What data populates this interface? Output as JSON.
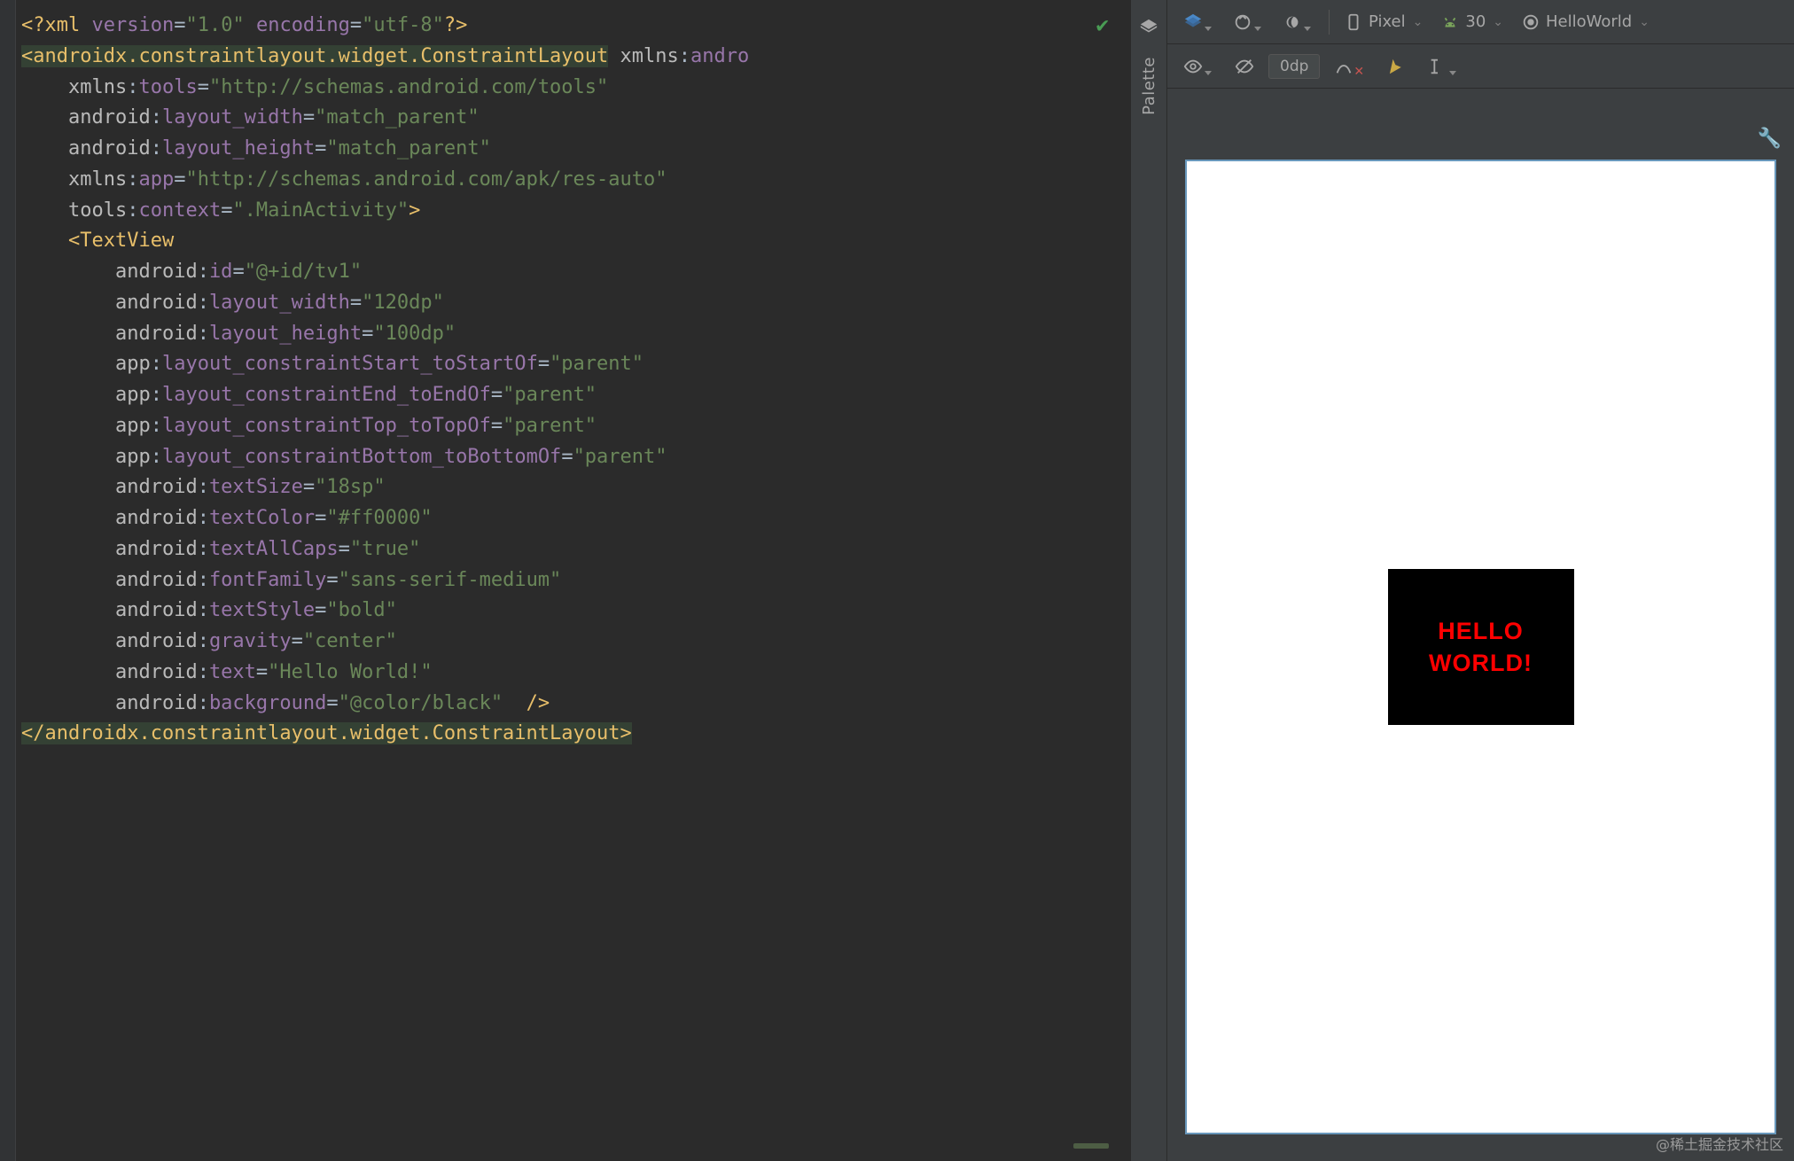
{
  "toolbar": {
    "device": "Pixel",
    "api": "30",
    "config": "HelloWorld",
    "zoom": "0dp"
  },
  "palette": {
    "label": "Palette"
  },
  "preview": {
    "text": "HELLO WORLD!"
  },
  "watermark": "@稀土掘金技术社区",
  "code": {
    "lines": [
      [
        [
          "tok-pi",
          "<?"
        ],
        [
          "tok-tag",
          "xml"
        ],
        [
          "plain",
          " "
        ],
        [
          "tok-attr",
          "version"
        ],
        [
          "tok-op",
          "="
        ],
        [
          "tok-str",
          "\"1.0\""
        ],
        [
          "plain",
          " "
        ],
        [
          "tok-attr",
          "encoding"
        ],
        [
          "tok-op",
          "="
        ],
        [
          "tok-str",
          "\"utf-8\""
        ],
        [
          "tok-pi",
          "?>"
        ]
      ],
      [
        [
          "sel-open",
          ""
        ],
        [
          "tok-bracket",
          "<"
        ],
        [
          "tok-tag",
          "androidx.constraintlayout.widget.ConstraintLayout"
        ],
        [
          "sel-close",
          ""
        ],
        [
          "plain",
          " "
        ],
        [
          "tok-ns",
          "xmlns"
        ],
        [
          "tok-op",
          ":"
        ],
        [
          "tok-attr",
          "andro"
        ]
      ],
      [
        [
          "indent1",
          ""
        ],
        [
          "tok-ns",
          "xmlns"
        ],
        [
          "tok-op",
          ":"
        ],
        [
          "tok-attr",
          "tools"
        ],
        [
          "tok-op",
          "="
        ],
        [
          "tok-str",
          "\"http://schemas.android.com/tools\""
        ]
      ],
      [
        [
          "indent1",
          ""
        ],
        [
          "tok-ns",
          "android"
        ],
        [
          "tok-op",
          ":"
        ],
        [
          "tok-attr",
          "layout_width"
        ],
        [
          "tok-op",
          "="
        ],
        [
          "tok-str",
          "\"match_parent\""
        ]
      ],
      [
        [
          "indent1",
          ""
        ],
        [
          "tok-ns",
          "android"
        ],
        [
          "tok-op",
          ":"
        ],
        [
          "tok-attr",
          "layout_height"
        ],
        [
          "tok-op",
          "="
        ],
        [
          "tok-str",
          "\"match_parent\""
        ]
      ],
      [
        [
          "indent1",
          ""
        ],
        [
          "tok-ns",
          "xmlns"
        ],
        [
          "tok-op",
          ":"
        ],
        [
          "tok-attr",
          "app"
        ],
        [
          "tok-op",
          "="
        ],
        [
          "tok-str",
          "\"http://schemas.android.com/apk/res-auto\""
        ]
      ],
      [
        [
          "indent1",
          ""
        ],
        [
          "tok-ns",
          "tools"
        ],
        [
          "tok-op",
          ":"
        ],
        [
          "tok-attr",
          "context"
        ],
        [
          "tok-op",
          "="
        ],
        [
          "tok-str",
          "\".MainActivity\""
        ],
        [
          "tok-bracket",
          ">"
        ]
      ],
      [
        [
          "indent1",
          ""
        ],
        [
          "tok-bracket",
          "<"
        ],
        [
          "tok-tag",
          "TextView"
        ]
      ],
      [
        [
          "indent2",
          ""
        ],
        [
          "tok-ns",
          "android"
        ],
        [
          "tok-op",
          ":"
        ],
        [
          "tok-attr",
          "id"
        ],
        [
          "tok-op",
          "="
        ],
        [
          "tok-str",
          "\"@+id/tv1\""
        ]
      ],
      [
        [
          "indent2",
          ""
        ],
        [
          "tok-ns",
          "android"
        ],
        [
          "tok-op",
          ":"
        ],
        [
          "tok-attr",
          "layout_width"
        ],
        [
          "tok-op",
          "="
        ],
        [
          "tok-str",
          "\"120dp\""
        ]
      ],
      [
        [
          "indent2",
          ""
        ],
        [
          "tok-ns",
          "android"
        ],
        [
          "tok-op",
          ":"
        ],
        [
          "tok-attr",
          "layout_height"
        ],
        [
          "tok-op",
          "="
        ],
        [
          "tok-str",
          "\"100dp\""
        ]
      ],
      [
        [
          "indent2",
          ""
        ],
        [
          "tok-ns-app",
          "app"
        ],
        [
          "tok-op",
          ":"
        ],
        [
          "tok-attr",
          "layout_constraintStart_toStartOf"
        ],
        [
          "tok-op",
          "="
        ],
        [
          "tok-str",
          "\"parent\""
        ]
      ],
      [
        [
          "indent2",
          ""
        ],
        [
          "tok-ns-app",
          "app"
        ],
        [
          "tok-op",
          ":"
        ],
        [
          "tok-attr",
          "layout_constraintEnd_toEndOf"
        ],
        [
          "tok-op",
          "="
        ],
        [
          "tok-str",
          "\"parent\""
        ]
      ],
      [
        [
          "indent2",
          ""
        ],
        [
          "tok-ns-app",
          "app"
        ],
        [
          "tok-op",
          ":"
        ],
        [
          "tok-attr",
          "layout_constraintTop_toTopOf"
        ],
        [
          "tok-op",
          "="
        ],
        [
          "tok-str",
          "\"parent\""
        ]
      ],
      [
        [
          "indent2",
          ""
        ],
        [
          "tok-ns-app",
          "app"
        ],
        [
          "tok-op",
          ":"
        ],
        [
          "tok-attr",
          "layout_constraintBottom_toBottomOf"
        ],
        [
          "tok-op",
          "="
        ],
        [
          "tok-str",
          "\"parent\""
        ]
      ],
      [
        [
          "indent2",
          ""
        ],
        [
          "tok-ns",
          "android"
        ],
        [
          "tok-op",
          ":"
        ],
        [
          "tok-attr",
          "textSize"
        ],
        [
          "tok-op",
          "="
        ],
        [
          "tok-str",
          "\"18sp\""
        ]
      ],
      [
        [
          "indent2",
          ""
        ],
        [
          "tok-ns",
          "android"
        ],
        [
          "tok-op",
          ":"
        ],
        [
          "tok-attr",
          "textColor"
        ],
        [
          "tok-op",
          "="
        ],
        [
          "tok-str",
          "\"#ff0000\""
        ]
      ],
      [
        [
          "indent2",
          ""
        ],
        [
          "tok-ns",
          "android"
        ],
        [
          "tok-op",
          ":"
        ],
        [
          "tok-attr",
          "textAllCaps"
        ],
        [
          "tok-op",
          "="
        ],
        [
          "tok-str",
          "\"true\""
        ]
      ],
      [
        [
          "indent2",
          ""
        ],
        [
          "tok-ns",
          "android"
        ],
        [
          "tok-op",
          ":"
        ],
        [
          "tok-attr",
          "fontFamily"
        ],
        [
          "tok-op",
          "="
        ],
        [
          "tok-str",
          "\"sans-serif-medium\""
        ]
      ],
      [
        [
          "indent2",
          ""
        ],
        [
          "tok-ns",
          "android"
        ],
        [
          "tok-op",
          ":"
        ],
        [
          "tok-attr",
          "textStyle"
        ],
        [
          "tok-op",
          "="
        ],
        [
          "tok-str",
          "\"bold\""
        ]
      ],
      [
        [
          "indent2",
          ""
        ],
        [
          "tok-ns",
          "android"
        ],
        [
          "tok-op",
          ":"
        ],
        [
          "tok-attr",
          "gravity"
        ],
        [
          "tok-op",
          "="
        ],
        [
          "tok-str",
          "\"center\""
        ]
      ],
      [
        [
          "indent2",
          ""
        ],
        [
          "tok-ns",
          "android"
        ],
        [
          "tok-op",
          ":"
        ],
        [
          "tok-attr",
          "text"
        ],
        [
          "tok-op",
          "="
        ],
        [
          "tok-str",
          "\"Hello World!\""
        ]
      ],
      [
        [
          "indent2",
          ""
        ],
        [
          "tok-ns",
          "android"
        ],
        [
          "tok-op",
          ":"
        ],
        [
          "tok-attr",
          "background"
        ],
        [
          "tok-op",
          "="
        ],
        [
          "tok-str",
          "\"@color/black\""
        ],
        [
          "plain",
          "  "
        ],
        [
          "tok-bracket",
          "/>"
        ]
      ],
      [
        [
          "sel-open",
          ""
        ],
        [
          "tok-bracket",
          "</"
        ],
        [
          "tok-tag",
          "androidx.constraintlayout.widget.ConstraintLayout"
        ],
        [
          "tok-bracket",
          ">"
        ],
        [
          "sel-close",
          ""
        ]
      ]
    ]
  }
}
